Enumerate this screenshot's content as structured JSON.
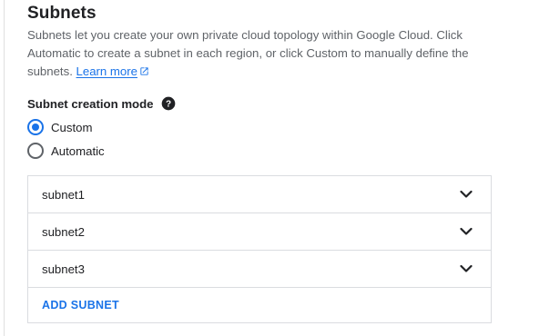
{
  "section": {
    "title": "Subnets",
    "description": "Subnets let you create your own private cloud topology within Google Cloud. Click Automatic to create a subnet in each region, or click Custom to manually define the subnets.",
    "learn_more": "Learn more",
    "external_icon": "open-in-new-icon"
  },
  "mode": {
    "label": "Subnet creation mode",
    "help_icon": "help-icon",
    "options": [
      {
        "label": "Custom",
        "checked": true
      },
      {
        "label": "Automatic",
        "checked": false
      }
    ]
  },
  "subnets": [
    {
      "name": "subnet1",
      "icon": "chevron-down-icon"
    },
    {
      "name": "subnet2",
      "icon": "chevron-down-icon"
    },
    {
      "name": "subnet3",
      "icon": "chevron-down-icon"
    }
  ],
  "add_subnet_label": "ADD SUBNET",
  "colors": {
    "accent": "#1a73e8",
    "text": "#202124",
    "secondary_text": "#5f6368",
    "border": "#dadce0"
  }
}
